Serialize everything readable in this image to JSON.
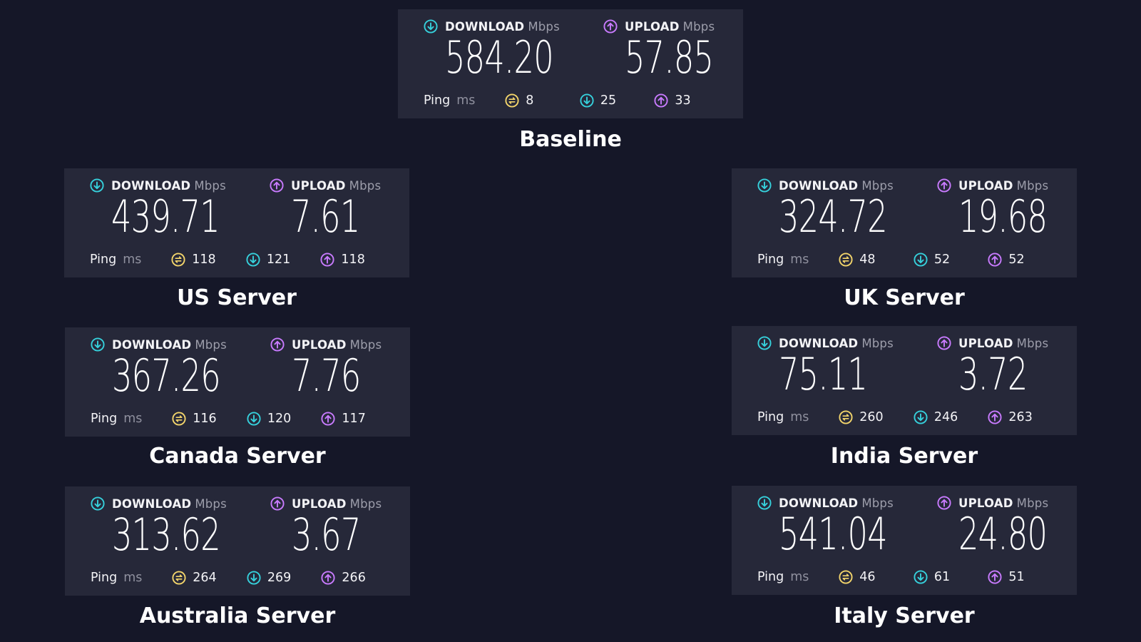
{
  "colors": {
    "background": "#151728",
    "card": "#262839",
    "download_accent": "#36d1dc",
    "upload_accent": "#c97bff",
    "ping_accent": "#f3d56b"
  },
  "labels": {
    "download": "DOWNLOAD",
    "upload": "UPLOAD",
    "speed_unit": "Mbps",
    "ping": "Ping",
    "ping_unit": "ms"
  },
  "icons": {
    "download": "arrow-down-circle-icon",
    "upload": "arrow-up-circle-icon",
    "ping": "idle-ping-icon"
  },
  "tests": [
    {
      "title": "Baseline",
      "download": "584.20",
      "upload": "57.85",
      "ping_idle": "8",
      "ping_download": "25",
      "ping_upload": "33"
    },
    {
      "title": "US Server",
      "download": "439.71",
      "upload": "7.61",
      "ping_idle": "118",
      "ping_download": "121",
      "ping_upload": "118"
    },
    {
      "title": "UK Server",
      "download": "324.72",
      "upload": "19.68",
      "ping_idle": "48",
      "ping_download": "52",
      "ping_upload": "52"
    },
    {
      "title": "Canada Server",
      "download": "367.26",
      "upload": "7.76",
      "ping_idle": "116",
      "ping_download": "120",
      "ping_upload": "117"
    },
    {
      "title": "India Server",
      "download": "75.11",
      "upload": "3.72",
      "ping_idle": "260",
      "ping_download": "246",
      "ping_upload": "263"
    },
    {
      "title": "Australia Server",
      "download": "313.62",
      "upload": "3.67",
      "ping_idle": "264",
      "ping_download": "269",
      "ping_upload": "266"
    },
    {
      "title": "Italy Server",
      "download": "541.04",
      "upload": "24.80",
      "ping_idle": "46",
      "ping_download": "61",
      "ping_upload": "51"
    }
  ]
}
